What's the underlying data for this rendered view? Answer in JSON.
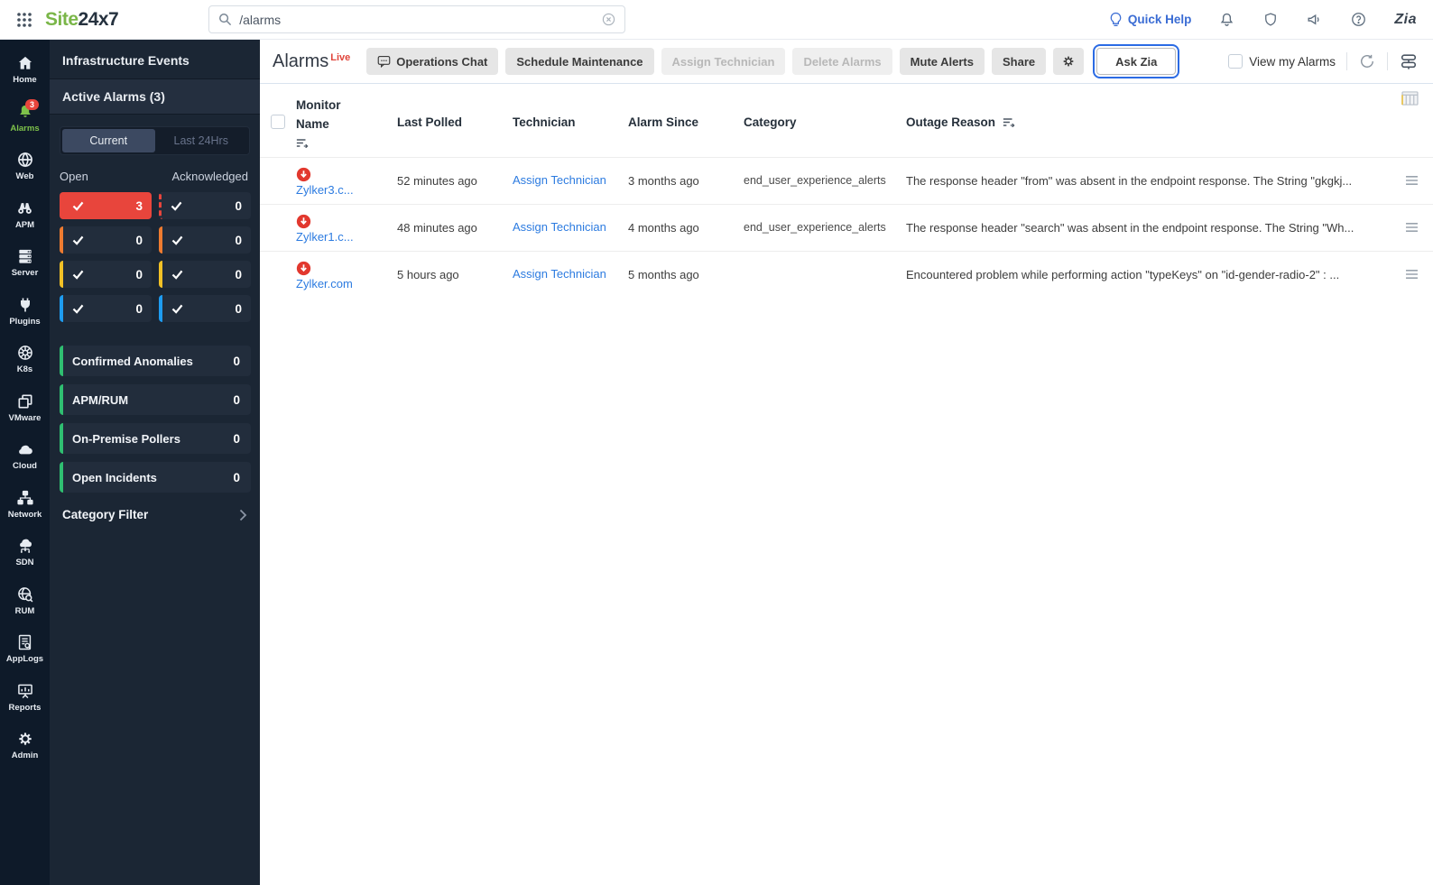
{
  "topbar": {
    "logo_site": "Site",
    "logo_247": "24x7",
    "search_value": "/alarms",
    "quick_help": "Quick Help",
    "zia_logo": "Zia"
  },
  "rail": {
    "items": [
      {
        "label": "Home"
      },
      {
        "label": "Alarms",
        "badge": "3"
      },
      {
        "label": "Web"
      },
      {
        "label": "APM"
      },
      {
        "label": "Server"
      },
      {
        "label": "Plugins"
      },
      {
        "label": "K8s"
      },
      {
        "label": "VMware"
      },
      {
        "label": "Cloud"
      },
      {
        "label": "Network"
      },
      {
        "label": "SDN"
      },
      {
        "label": "RUM"
      },
      {
        "label": "AppLogs"
      },
      {
        "label": "Reports"
      },
      {
        "label": "Admin"
      }
    ]
  },
  "panel": {
    "title": "Infrastructure Events",
    "active_alarms_label": "Active Alarms  (3)",
    "tab_current": "Current",
    "tab_last24": "Last 24Hrs",
    "col_open": "Open",
    "col_acknowledged": "Acknowledged",
    "open_counts": [
      "3",
      "0",
      "0",
      "0"
    ],
    "ack_counts": [
      "0",
      "0",
      "0",
      "0"
    ],
    "severity_colors": [
      "#e8453c",
      "#ee7b30",
      "#f2c126",
      "#1e9cf0"
    ],
    "summary": [
      {
        "label": "Confirmed Anomalies",
        "count": "0"
      },
      {
        "label": "APM/RUM",
        "count": "0"
      },
      {
        "label": "On-Premise Pollers",
        "count": "0"
      },
      {
        "label": "Open Incidents",
        "count": "0"
      }
    ],
    "category_filter_label": "Category Filter"
  },
  "main": {
    "title": "Alarms",
    "live_badge": "Live",
    "buttons": {
      "operations_chat": "Operations Chat",
      "schedule_maintenance": "Schedule Maintenance",
      "assign_technician": "Assign Technician",
      "delete_alarms": "Delete Alarms",
      "mute_alerts": "Mute Alerts",
      "share": "Share",
      "ask_zia": "Ask Zia"
    },
    "view_my_alarms": "View my Alarms",
    "table": {
      "headers": {
        "monitor_name": "Monitor Name",
        "last_polled": "Last Polled",
        "technician": "Technician",
        "alarm_since": "Alarm Since",
        "category": "Category",
        "outage_reason": "Outage Reason"
      },
      "rows": [
        {
          "monitor": "Zylker3.c...",
          "status": "down",
          "last_polled": "52 minutes ago",
          "technician": "Assign Technician",
          "alarm_since": "3 months ago",
          "category": "end_user_experience_alerts",
          "outage_reason": "The response header \"from\" was absent in the endpoint response. The String \"gkgkj..."
        },
        {
          "monitor": "Zylker1.c...",
          "status": "down",
          "last_polled": "48 minutes ago",
          "technician": "Assign Technician",
          "alarm_since": "4 months ago",
          "category": "end_user_experience_alerts",
          "outage_reason": "The response header \"search\" was absent in the endpoint response. The String \"Wh..."
        },
        {
          "monitor": "Zylker.com",
          "status": "down",
          "last_polled": "5 hours ago",
          "technician": "Assign Technician",
          "alarm_since": "5 months ago",
          "category": "",
          "outage_reason": "Encountered problem while performing action \"typeKeys\" on \"id-gender-radio-2\" : ..."
        }
      ]
    }
  },
  "colors": {
    "brand_green": "#7ab648",
    "rail_bg": "#0e1a29",
    "panel_bg": "#1b2634",
    "alert_red": "#e8453c",
    "link_blue": "#2c7be0",
    "focus_ring_blue": "#2b6be4",
    "summary_green": "#2fbf71"
  }
}
